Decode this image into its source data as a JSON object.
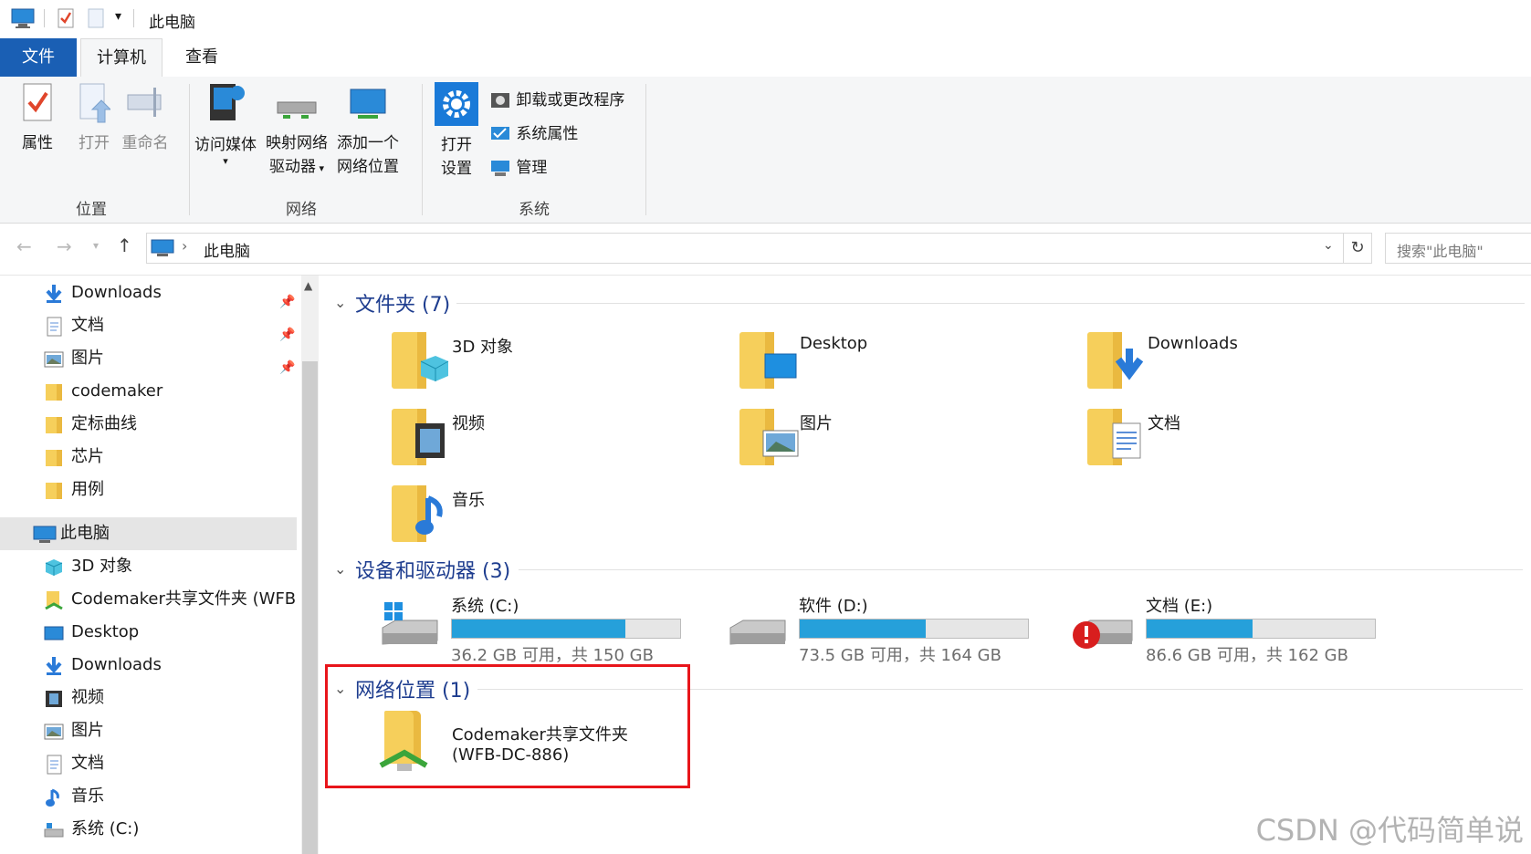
{
  "window": {
    "title": "此电脑"
  },
  "tabs": {
    "file": "文件",
    "computer": "计算机",
    "view": "查看"
  },
  "ribbon": {
    "location": {
      "group": "位置",
      "properties": "属性",
      "open": "打开",
      "rename": "重命名"
    },
    "network": {
      "group": "网络",
      "access_media": "访问媒体",
      "map_drive_1": "映射网络",
      "map_drive_2": "驱动器",
      "add_location_1": "添加一个",
      "add_location_2": "网络位置"
    },
    "system": {
      "group": "系统",
      "open_settings_1": "打开",
      "open_settings_2": "设置",
      "uninstall": "卸载或更改程序",
      "system_props": "系统属性",
      "manage": "管理"
    }
  },
  "addressbar": {
    "path": "此电脑",
    "search_placeholder": "搜索\"此电脑\""
  },
  "nav": {
    "quick": [
      {
        "label": "Downloads",
        "icon": "download-arrow-icon",
        "pinned": true
      },
      {
        "label": "文档",
        "icon": "document-icon",
        "pinned": true
      },
      {
        "label": "图片",
        "icon": "picture-icon",
        "pinned": true
      },
      {
        "label": "codemaker",
        "icon": "folder-icon"
      },
      {
        "label": "定标曲线",
        "icon": "folder-icon"
      },
      {
        "label": "芯片",
        "icon": "folder-icon"
      },
      {
        "label": "用例",
        "icon": "folder-icon"
      }
    ],
    "this_pc": "此电脑",
    "pc_items": [
      {
        "label": "3D 对象",
        "icon": "cube-icon"
      },
      {
        "label": "Codemaker共享文件夹 (WFB-",
        "icon": "network-folder-icon"
      },
      {
        "label": "Desktop",
        "icon": "desktop-icon"
      },
      {
        "label": "Downloads",
        "icon": "download-arrow-icon"
      },
      {
        "label": "视频",
        "icon": "video-icon"
      },
      {
        "label": "图片",
        "icon": "picture-icon"
      },
      {
        "label": "文档",
        "icon": "document-icon"
      },
      {
        "label": "音乐",
        "icon": "music-icon"
      },
      {
        "label": "系统 (C:)",
        "icon": "drive-icon"
      }
    ]
  },
  "folders": {
    "title": "文件夹 (7)",
    "items": [
      {
        "label": "3D 对象",
        "overlay": "cube"
      },
      {
        "label": "Desktop",
        "overlay": "desktop"
      },
      {
        "label": "Downloads",
        "overlay": "download"
      },
      {
        "label": "视频",
        "overlay": "video"
      },
      {
        "label": "图片",
        "overlay": "picture"
      },
      {
        "label": "文档",
        "overlay": "document"
      },
      {
        "label": "音乐",
        "overlay": "music"
      }
    ]
  },
  "drives": {
    "title": "设备和驱动器 (3)",
    "items": [
      {
        "label": "系统 (C:)",
        "info": "36.2 GB 可用，共 150 GB",
        "used_fraction": 0.759,
        "icon": "windows-drive"
      },
      {
        "label": "软件 (D:)",
        "info": "73.5 GB 可用，共 164 GB",
        "used_fraction": 0.552,
        "icon": "drive"
      },
      {
        "label": "文档 (E:)",
        "info": "86.6 GB 可用，共 162 GB",
        "used_fraction": 0.465,
        "icon": "warning-drive"
      }
    ]
  },
  "network_locations": {
    "title": "网络位置 (1)",
    "item_line1": "Codemaker共享文件夹",
    "item_line2": "(WFB-DC-886)"
  },
  "watermark": "CSDN @代码简单说",
  "colors": {
    "accent": "#1a5fb4",
    "bar": "#26a0da",
    "highlight_box": "#e8151b",
    "section_title": "#1e3d8f"
  }
}
